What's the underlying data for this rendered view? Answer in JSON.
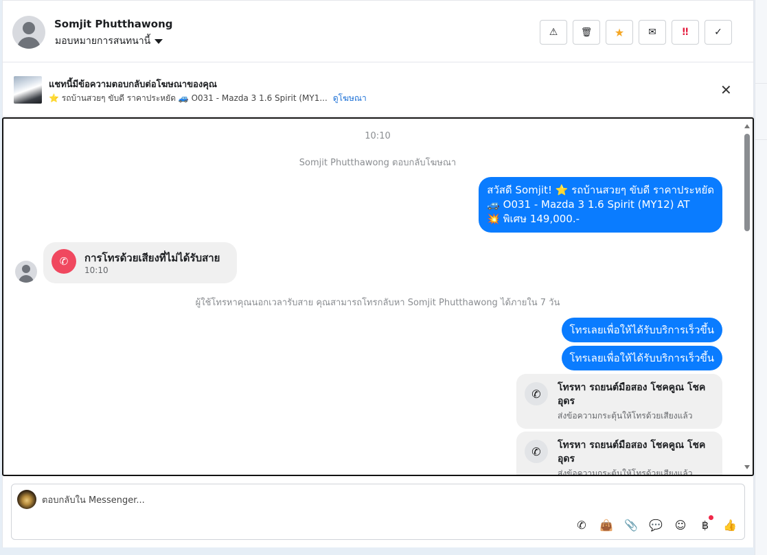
{
  "header": {
    "contact_name": "Somjit Phutthawong",
    "assign_label": "มอบหมายการสนทนานี้",
    "actions": [
      {
        "icon": "warning-icon",
        "glyph": "⚠"
      },
      {
        "icon": "trash-icon",
        "glyph": "🗑"
      },
      {
        "icon": "star-icon",
        "glyph": "★",
        "color": "#f5a623"
      },
      {
        "icon": "envelope-icon",
        "glyph": "✉"
      },
      {
        "icon": "priority-icon",
        "glyph": "‼",
        "color": "#e41e3f"
      },
      {
        "icon": "check-icon",
        "glyph": "✓"
      }
    ]
  },
  "ad_banner": {
    "title": "แชทนี้มีข้อความตอบกลับต่อโฆษณาของคุณ",
    "subtitle": "⭐ รถบ้านสวยๆ ขับดี ราคาประหยัด 🚙 O031 - Mazda 3 1.6 Spirit (MY1...",
    "link": "ดูโฆษณา",
    "close": "✕"
  },
  "chat": {
    "timestamp": "10:10",
    "reply_notice": "Somjit Phutthawong ตอบกลับโฆษณา",
    "outgoing_ad_lines": [
      "สวัสดี Somjit! ⭐ รถบ้านสวยๆ ขับดี ราคาประหยัด",
      "🚙 O031 - Mazda 3 1.6 Spirit (MY12) AT",
      "💥 พิเศษ 149,000.-"
    ],
    "missed_call": {
      "title": "การโทรด้วยเสียงที่ไม่ได้รับสาย",
      "time": "10:10"
    },
    "callback_notice": "ผู้ใช้โทรหาคุณนอกเวลารับสาย คุณสามารถโทรกลับหา Somjit Phutthawong ได้ภายใน 7 วัน",
    "call_now_messages": [
      "โทรเลยเพื่อให้ได้รับบริการเร็วขึ้น",
      "โทรเลยเพื่อให้ได้รับบริการเร็วขึ้น"
    ],
    "call_cards": [
      {
        "title": "โทรหา รถยนต์มือสอง โชคคูณ โชค อุดร",
        "subtitle": "ส่งข้อความกระตุ้นให้โทรด้วยเสียงแล้ว"
      },
      {
        "title": "โทรหา รถยนต์มือสอง โชคคูณ โชค อุดร",
        "subtitle": "ส่งข้อความกระตุ้นให้โทรด้วยเสียงแล้ว"
      }
    ]
  },
  "composer": {
    "placeholder": "ตอบกลับใน Messenger...",
    "tools": [
      {
        "icon": "phone-icon",
        "glyph": "✆"
      },
      {
        "icon": "shopping-bag-icon",
        "glyph": "👜"
      },
      {
        "icon": "paperclip-icon",
        "glyph": "📎"
      },
      {
        "icon": "chat-bubble-icon",
        "glyph": "💬"
      },
      {
        "icon": "emoji-icon",
        "glyph": "☺"
      },
      {
        "icon": "baht-icon",
        "glyph": "฿"
      },
      {
        "icon": "thumbs-up-icon",
        "glyph": "👍"
      }
    ]
  },
  "colors": {
    "accent_blue": "#0a7cff",
    "missed_red": "#f0485f",
    "link_blue": "#1a6fd6"
  }
}
